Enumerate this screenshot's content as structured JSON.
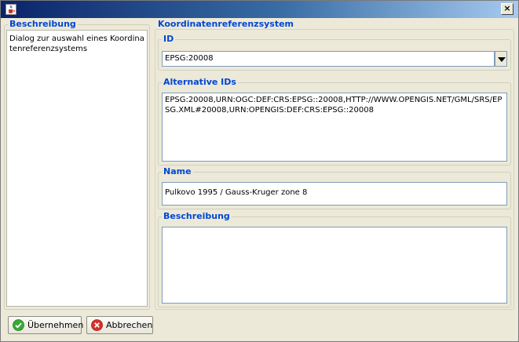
{
  "window": {
    "title": "",
    "close_label": "×"
  },
  "left_panel": {
    "legend": "Beschreibung",
    "text": "Dialog zur auswahl eines Koordinatenreferenzsystems"
  },
  "crs_panel": {
    "title": "Koordinatenreferenzsystem",
    "id": {
      "legend": "ID",
      "value": "EPSG:20008"
    },
    "alternative_ids": {
      "legend": "Alternative IDs",
      "value": "EPSG:20008,URN:OGC:DEF:CRS:EPSG::20008,HTTP://WWW.OPENGIS.NET/GML/SRS/EPSG.XML#20008,URN:OPENGIS:DEF:CRS:EPSG::20008"
    },
    "name": {
      "legend": "Name",
      "value": "Pulkovo 1995 / Gauss-Kruger zone 8"
    },
    "description": {
      "legend": "Beschreibung",
      "value": ""
    }
  },
  "buttons": {
    "apply_label": "Übernehmen",
    "cancel_label": "Abbrechen"
  },
  "icons": {
    "app": "java-cup-icon",
    "apply": "green-check-icon",
    "cancel": "red-x-icon"
  },
  "colors": {
    "legend": "#0046d5",
    "titlebar": "#0a246a"
  }
}
